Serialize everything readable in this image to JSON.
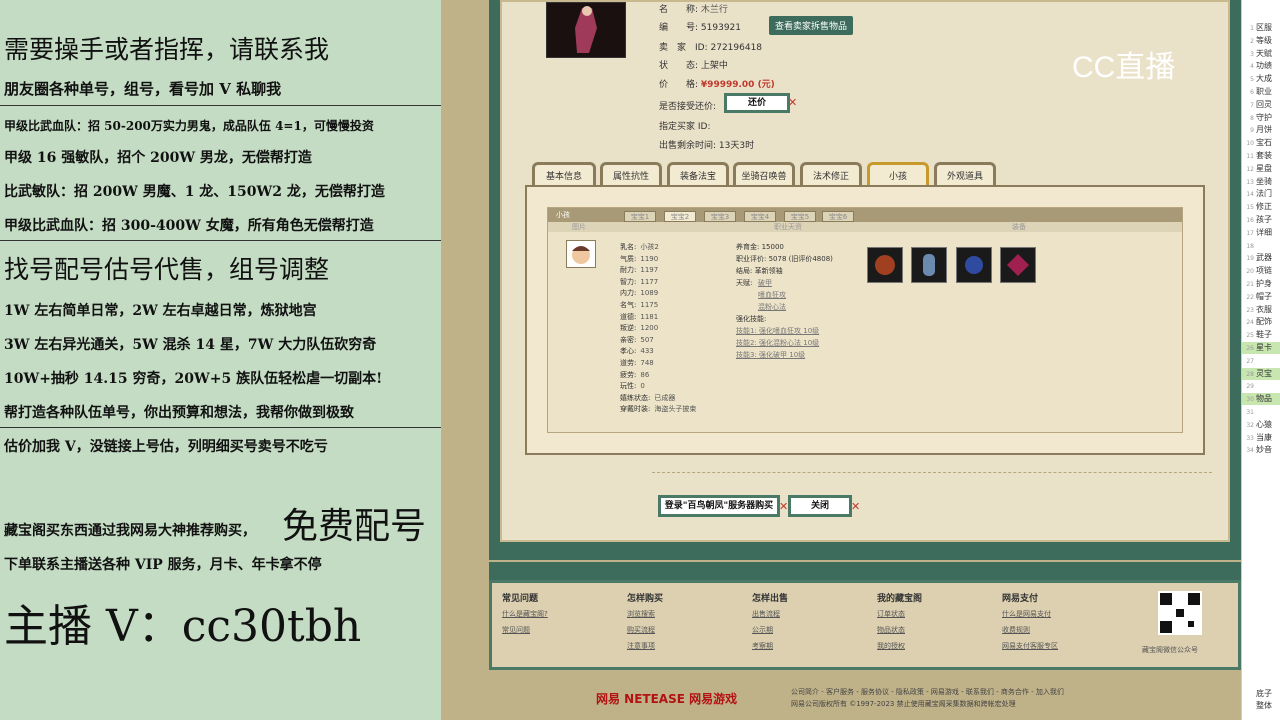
{
  "overlay": {
    "l1": "需要操手或者指挥，请联系我",
    "l2": "朋友圈各种单号，组号，看号加 V 私聊我",
    "l3": "甲级比武血队：招 50-200万实力男鬼，成品队伍 4=1，可慢慢投资",
    "l4": "甲级 16 强敏队，招个 200W 男龙，无偿帮打造",
    "l5": "比武敏队：招 200W 男魔、1 龙、150W2 龙，无偿帮打造",
    "l6": "甲级比武血队：招 300-400W 女魔，所有角色无偿帮打造",
    "l7": "找号配号估号代售，组号调整",
    "l8": "1W 左右简单日常，2W 左右卓越日常，炼狱地宫",
    "l9": "3W 左右异光通关，5W 混杀 14 星，7W 大力队伍砍穷奇",
    "l10": "10W+抽秒 14.15 穷奇，20W+5 族队伍轻松虐一切副本!",
    "l11": "帮打造各种队伍单号，你出预算和想法，我帮你做到极致",
    "l12": "估价加我 V，没链接上号估，列明细买号卖号不吃亏",
    "l13": "藏宝阁买东西通过我网易大神推荐购买，",
    "l13b": "免费配号",
    "l14": "下单联系主播送各种 VIP 服务，月卡、年卡拿不停",
    "l15": "主播 V：cc30tbh"
  },
  "watermark": "CC直播",
  "item": {
    "name_label": "名　　称:",
    "name_value": "木兰行",
    "id_label": "编　　号:",
    "id_value": "5193921",
    "view_btn": "查看卖家拆售物品",
    "seller_label": "卖　家　ID:",
    "seller_value": "272196418",
    "status_label": "状　　态:",
    "status_value": "上架中",
    "price_label": "价　　格:",
    "price_value": "¥99999.00 (元)",
    "bargain_label": "是否接受还价:",
    "bargain_btn": "还价",
    "buyer_label": "指定买家 ID:",
    "time_label": "出售剩余时间:",
    "time_value": "13天3时"
  },
  "tabs": [
    "基本信息",
    "属性抗性",
    "装备法宝",
    "坐骑召唤兽",
    "法术修正",
    "小孩",
    "外观道具"
  ],
  "child": {
    "title": "小孩",
    "subtabs": [
      "宝宝1",
      "宝宝2",
      "宝宝3",
      "宝宝4",
      "宝宝5",
      "宝宝6"
    ],
    "col_img": "图片",
    "col_mid": "职业天资",
    "col_eq": "装备",
    "attrs": [
      [
        "乳名:",
        "小孩2"
      ],
      [
        "气质:",
        "1190"
      ],
      [
        "耐力:",
        "1197"
      ],
      [
        "智力:",
        "1177"
      ],
      [
        "内力:",
        "1089"
      ],
      [
        "名气:",
        "1175"
      ],
      [
        "道德:",
        "1181"
      ],
      [
        "叛逆:",
        "1200"
      ],
      [
        "亲密:",
        "507"
      ],
      [
        "孝心:",
        "433"
      ],
      [
        "道劳:",
        "748"
      ],
      [
        "疲劳:",
        "86"
      ],
      [
        "玩性:",
        "0"
      ],
      [
        "嬉练状态:",
        "已成器"
      ],
      [
        "穿戴时装:",
        "海盗头子披束"
      ]
    ],
    "money": "养育金: 15000",
    "rating": "职业评价: 5078 (旧评价4808)",
    "ending": "结局: 革新领袖",
    "talent_label": "天赋:",
    "talents": [
      "破甲",
      "嗜血狂攻",
      "混粉心法"
    ],
    "skill_label": "强化技能:",
    "skills": [
      "技能1: 强化嗜血狂攻 10级",
      "技能2: 强化混粉心法 10级",
      "技能3: 强化破甲 10级"
    ]
  },
  "buttons": {
    "login": "登录\"百鸟朝凤\"服务器购买",
    "close": "关闭"
  },
  "footer": {
    "cols": [
      {
        "h": "常见问题",
        "links": [
          "什么是藏宝阁?",
          "常见问题"
        ]
      },
      {
        "h": "怎样购买",
        "links": [
          "浏览搜索",
          "购买流程",
          "注意事项"
        ]
      },
      {
        "h": "怎样出售",
        "links": [
          "出售流程",
          "公示期",
          "考察期"
        ]
      },
      {
        "h": "我的藏宝阁",
        "links": [
          "订单状态",
          "物品状态",
          "我的授权"
        ]
      },
      {
        "h": "网易支付",
        "links": [
          "什么是网易支付",
          "收费规则",
          "网易支付客服专区"
        ]
      }
    ],
    "qr_label": "藏宝阁微信公众号",
    "brand": "网易 NETEASE  网易游戏",
    "copy1": "公司简介 - 客户服务 - 服务协议 - 隐私政策 - 网易游戏 - 联系我们 - 商务合作 - 加入我们",
    "copy2": "网易公司版权所有 ©1997-2023 禁止使用藏宝阁采集数据和跨帐宏处理"
  },
  "sidebar": [
    "区服",
    "等级",
    "天赋",
    "功绩",
    "大成",
    "职业",
    "回灵",
    "守护",
    "月饼",
    "宝石",
    "套装",
    "星盘",
    "坐骑",
    "法门",
    "修正",
    "孩子",
    "详细",
    "",
    "武器",
    "项链",
    "护身",
    "帽子",
    "衣服",
    "配饰",
    "鞋子",
    "星卡",
    "",
    "灵宝",
    "",
    "物品",
    "",
    "心猿",
    "当康",
    "妙音"
  ],
  "sidebar_bottom": [
    "底子",
    "整体"
  ]
}
